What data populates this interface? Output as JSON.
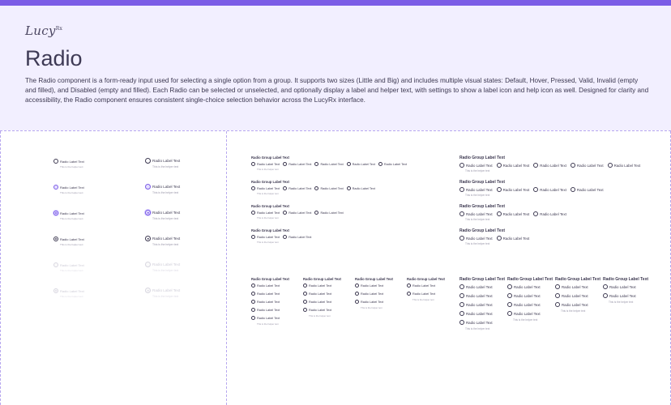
{
  "brand": {
    "logo": "Lucy",
    "logo_sup": "Rx",
    "accent": "#7b5ce6",
    "header_bg": "#f2efff"
  },
  "header": {
    "title": "Radio",
    "description": "The Radio component is a form-ready input used for selecting a single option from a group. It supports two sizes (Little and Big) and includes multiple visual states: Default, Hover, Pressed, Valid, Invalid (empty and filled), and Disabled (empty and filled). Each Radio can be selected or unselected, and optionally display a label and helper text, with settings to show a label icon and help icon as well. Designed for clarity and accessibility, the Radio component ensures consistent single-choice selection behavior across the LucyRx interface."
  },
  "radio": {
    "label": "Radio Label Text",
    "helper": "This is the helper text"
  },
  "group": {
    "title": "Radio Group Label Text",
    "option": "Radio Label Text",
    "helper": "This is the helper text"
  }
}
